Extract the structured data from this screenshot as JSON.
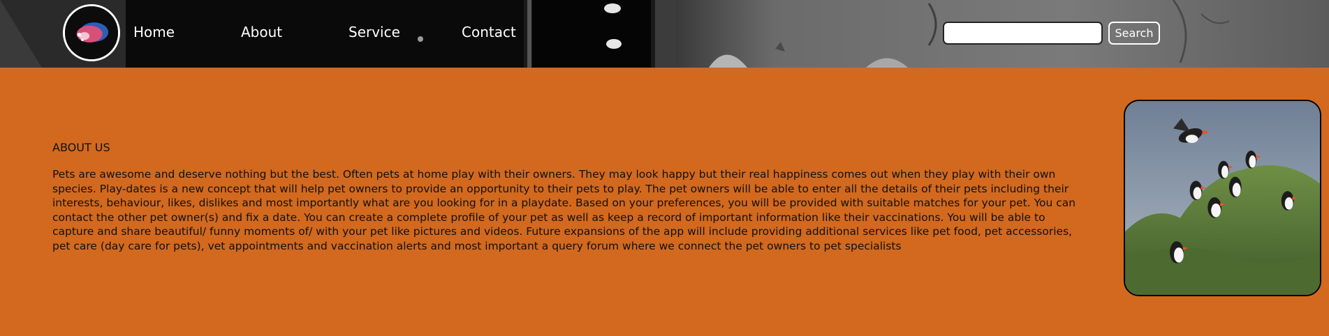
{
  "header": {
    "nav": {
      "home": "Home",
      "about": "About",
      "service": "Service",
      "contact": "Contact"
    },
    "search": {
      "value": "",
      "placeholder": "",
      "button_label": "Search"
    }
  },
  "main": {
    "heading": "ABOUT US",
    "body": "Pets are awesome and deserve nothing but the best. Often pets at home play with their owners. They may look happy but their real happiness comes out when they play with their own species. Play-dates is a new concept that will help pet owners to provide an opportunity to their pets to play. The pet owners will be able to enter all the details of their pets including their interests, behaviour, likes, dislikes and most importantly what are you looking for in a playdate. Based on your preferences, you will be provided with suitable matches for your pet. You can contact the other pet owner(s) and fix a date. You can create a complete profile of your pet as well as keep a record of important information like their vaccinations. You will be able to capture and share beautiful/ funny moments of/ with your pet like pictures and videos. Future expansions of the app will include providing additional services like pet food, pet accessories, pet care (day care for pets), vet appointments and vaccination alerts and most important a query forum where we connect the pet owners to pet specialists"
  },
  "colors": {
    "page_background": "#d2691e",
    "header_text": "#ffffff",
    "body_text": "#111111"
  }
}
